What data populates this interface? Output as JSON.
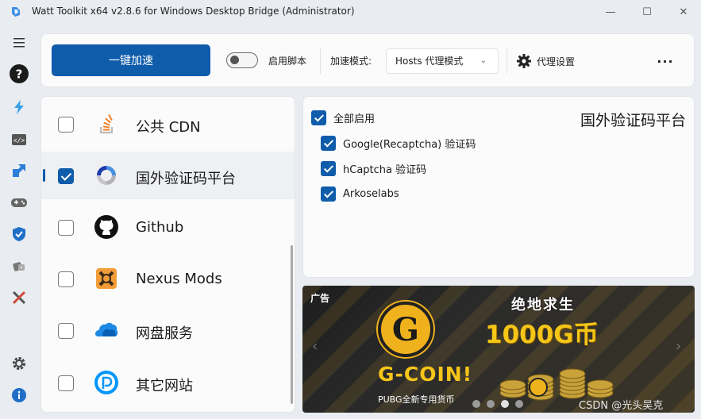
{
  "window": {
    "title": "Watt Toolkit x64 v2.8.6 for Windows Desktop Bridge (Administrator)",
    "min_glyph": "—",
    "max_glyph": "☐",
    "close_glyph": "✕"
  },
  "rail": {
    "items": [
      {
        "icon": "menu-icon"
      },
      {
        "icon": "help-icon"
      },
      {
        "icon": "lightning-icon"
      },
      {
        "icon": "code-icon"
      },
      {
        "icon": "transfer-icon"
      },
      {
        "icon": "gamepad-icon"
      },
      {
        "icon": "shield-icon"
      },
      {
        "icon": "dice-icon"
      },
      {
        "icon": "tools-icon"
      },
      {
        "icon": "settings-icon"
      },
      {
        "icon": "info-icon"
      }
    ]
  },
  "toolbar": {
    "accelerate_label": "一键加速",
    "script_toggle_label": "启用脚本",
    "script_enabled": false,
    "mode_label": "加速模式:",
    "mode_value": "Hosts 代理模式",
    "proxy_settings_label": "代理设置",
    "more_glyph": "···"
  },
  "list": {
    "items": [
      {
        "label": "公共 CDN",
        "checked": false,
        "selected": false,
        "icon": "stackoverflow-icon"
      },
      {
        "label": "国外验证码平台",
        "checked": true,
        "selected": true,
        "icon": "recaptcha-icon"
      },
      {
        "label": "Github",
        "checked": false,
        "selected": false,
        "icon": "github-icon"
      },
      {
        "label": "Nexus Mods",
        "checked": false,
        "selected": false,
        "icon": "nexusmods-icon"
      },
      {
        "label": "网盘服务",
        "checked": false,
        "selected": false,
        "icon": "onedrive-icon"
      },
      {
        "label": "其它网站",
        "checked": false,
        "selected": false,
        "icon": "pixiv-icon"
      }
    ]
  },
  "detail": {
    "title": "国外验证码平台",
    "enable_all_label": "全部启用",
    "options": [
      {
        "label": "Google(Recaptcha) 验证码",
        "checked": true
      },
      {
        "label": "hCaptcha 验证码",
        "checked": true
      },
      {
        "label": "Arkoselabs",
        "checked": true
      }
    ]
  },
  "ad": {
    "tag": "广告",
    "logo_letter": "G",
    "brand": "G-COIN!",
    "subtitle": "PUBG全新专用货币",
    "headline1": "绝地求生",
    "headline2": "1000G币",
    "prev_glyph": "‹",
    "next_glyph": "›",
    "dot_count": 4,
    "active_dot": 2,
    "watermark": "CSDN @光头吴克"
  },
  "colors": {
    "accent": "#0f5cab",
    "ad_gold": "#f5c518"
  }
}
